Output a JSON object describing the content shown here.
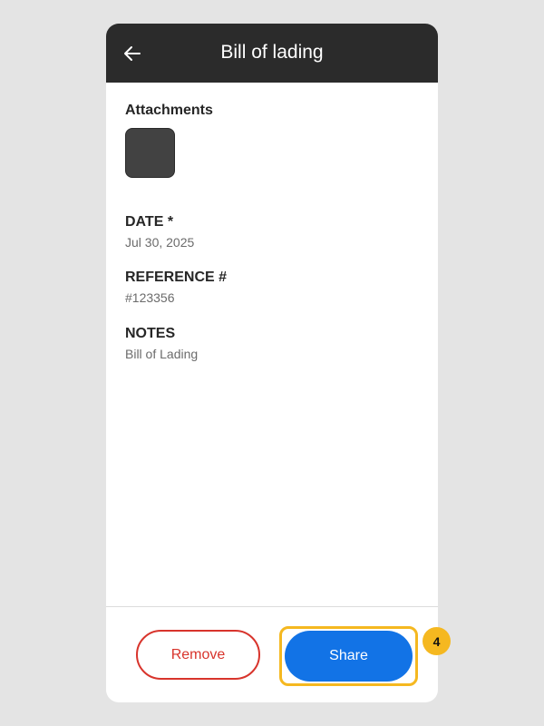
{
  "header": {
    "title": "Bill of lading",
    "back_icon": "arrow-left-icon"
  },
  "attachments": {
    "label": "Attachments",
    "thumbnail_color": "#424242"
  },
  "fields": {
    "date": {
      "label": "DATE *",
      "value": "Jul 30, 2025"
    },
    "reference": {
      "label": "REFERENCE #",
      "value": "#123356"
    },
    "notes": {
      "label": "NOTES",
      "value": "Bill of Lading"
    }
  },
  "actions": {
    "remove_label": "Remove",
    "share_label": "Share"
  },
  "annotation": {
    "step_number": "4",
    "highlight_color": "#f5b820"
  },
  "colors": {
    "appbar": "#2b2b2b",
    "primary": "#1273e6",
    "danger": "#d8342c"
  }
}
